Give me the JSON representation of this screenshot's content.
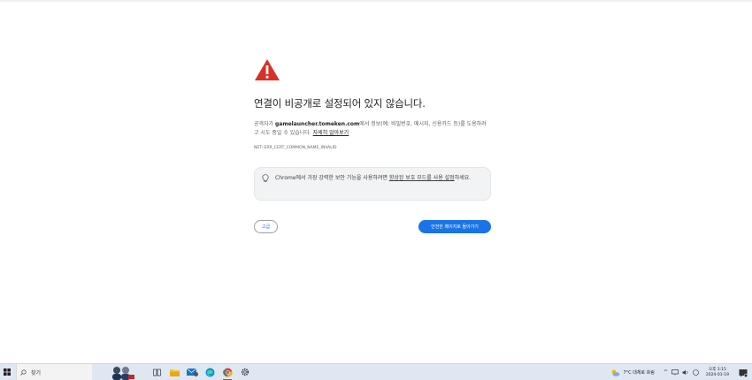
{
  "page": {
    "title": "연결이 비공개로 설정되어 있지 않습니다.",
    "desc_prefix": "공격자가 ",
    "host": "gamelauncher.tomeken.com",
    "desc_suffix": "에서 정보(예: 비밀번호, 메시지, 신용카드 등)를 도용하려고 시도 중일 수 있습니다. ",
    "learn_more": "자세히 알아보기",
    "error_code": "NET::ERR_CERT_COMMON_NAME_INVALID"
  },
  "tip": {
    "prefix": "Chrome에서 가장 강력한 보안 기능을 사용하려면 ",
    "link": "향상된 보호 모드를 사용 설정",
    "suffix": "하세요."
  },
  "buttons": {
    "advanced": "고급",
    "back_to_safety": "안전한 페이지로 돌아가기"
  },
  "taskbar": {
    "search_label": "찾기",
    "weather": "7°C  대체로 흐림",
    "time": "오후 3:15",
    "date": "2024-01-19",
    "apps": [
      "task-view-icon",
      "file-explorer-icon",
      "mail-icon",
      "edge-icon",
      "chrome-icon",
      "settings-icon"
    ]
  },
  "colors": {
    "warning": "#d93025",
    "accent": "#1a73e8"
  }
}
